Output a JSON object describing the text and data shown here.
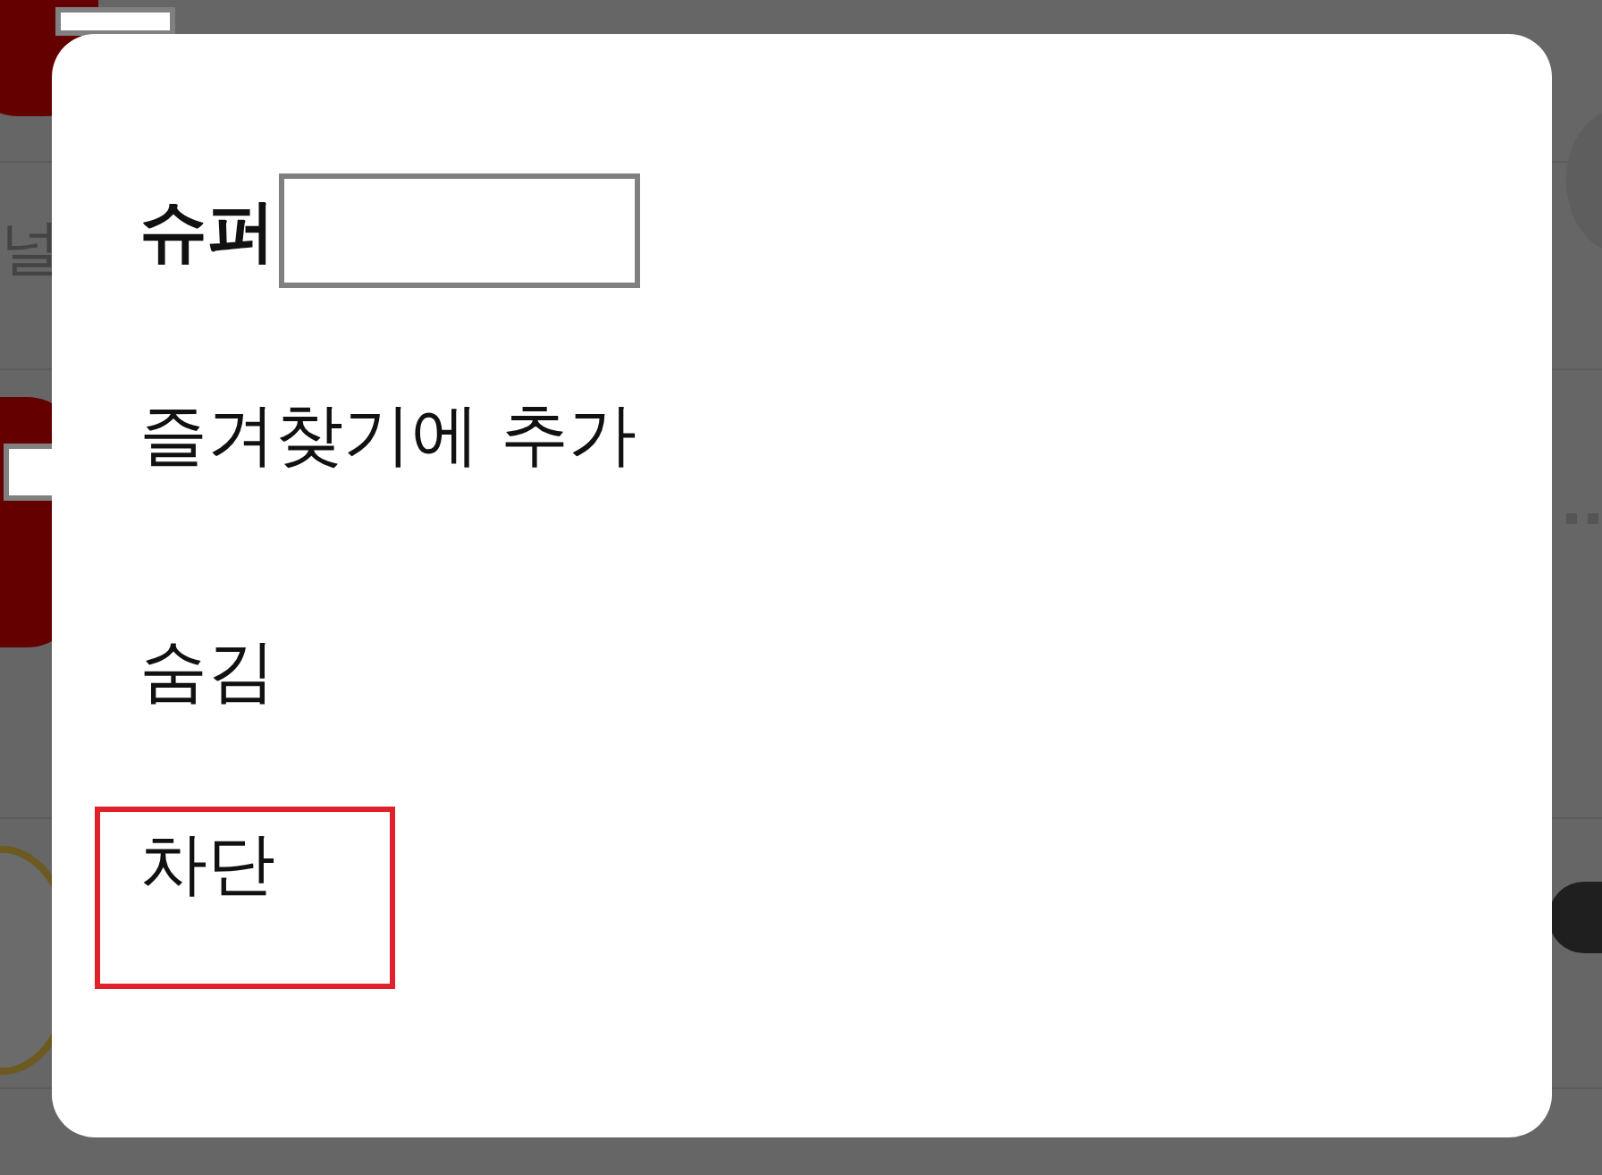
{
  "background": {
    "side_text": "널"
  },
  "dialog": {
    "title": "슈퍼",
    "items": [
      {
        "label": "즐겨찾기에 추가",
        "highlighted": false
      },
      {
        "label": "숨김",
        "highlighted": false
      },
      {
        "label": "차단",
        "highlighted": true
      }
    ]
  }
}
